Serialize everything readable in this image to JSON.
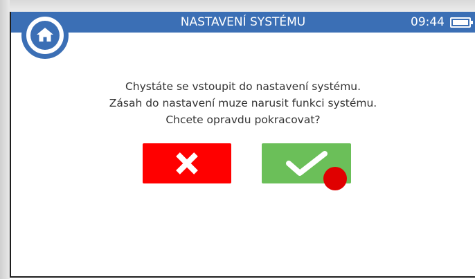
{
  "header": {
    "title": "NASTAVENÍ SYSTÉMU",
    "time": "09:44",
    "battery_icon": "battery-full-icon",
    "home_icon": "home-icon"
  },
  "dialog": {
    "lines": [
      "Chystáte se vstoupit do nastavení systému.",
      "Zásah do nastavení muze narusit funkci systému.",
      "Chcete opravdu pokracovat?"
    ],
    "cancel_icon": "close-icon",
    "confirm_icon": "checkmark-icon"
  },
  "colors": {
    "header": "#3b6fb5",
    "cancel": "#ff0000",
    "confirm": "#6bbf59",
    "tap_marker": "#e00000"
  }
}
